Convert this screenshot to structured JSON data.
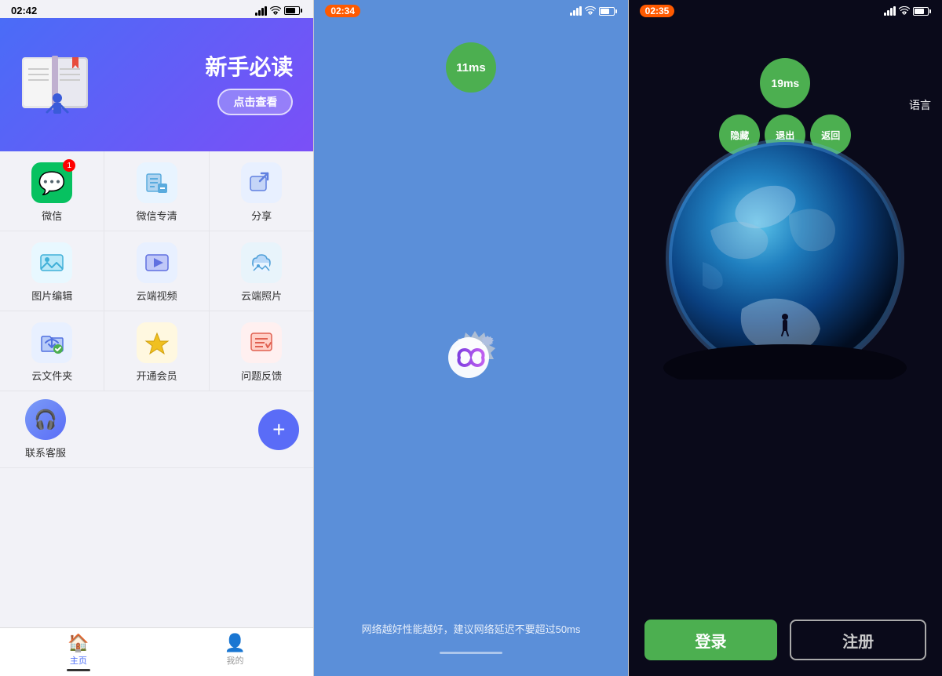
{
  "phone1": {
    "time": "02:42",
    "banner": {
      "title": "新手必读",
      "button": "点击查看"
    },
    "grid": [
      [
        {
          "label": "微信",
          "icon": "💬",
          "iconClass": "icon-wechat",
          "badge": "1"
        },
        {
          "label": "微信专清",
          "icon": "🧹",
          "iconClass": "icon-wechat-clean"
        },
        {
          "label": "分享",
          "icon": "↗",
          "iconClass": "icon-share"
        }
      ],
      [
        {
          "label": "图片编辑",
          "icon": "🖼",
          "iconClass": "icon-photo-edit"
        },
        {
          "label": "云端视频",
          "icon": "▶",
          "iconClass": "icon-cloud-video"
        },
        {
          "label": "云端照片",
          "icon": "🌤",
          "iconClass": "icon-cloud-photo"
        }
      ],
      [
        {
          "label": "云文件夹",
          "icon": "☁",
          "iconClass": "icon-cloud-folder"
        },
        {
          "label": "开通会员",
          "icon": "👑",
          "iconClass": "icon-vip"
        },
        {
          "label": "问题反馈",
          "icon": "📝",
          "iconClass": "icon-feedback"
        }
      ]
    ],
    "service": {
      "label": "联系客服",
      "icon": "🎧"
    },
    "add_label": "+",
    "tabs": [
      {
        "label": "主页",
        "icon": "🏠",
        "active": true
      },
      {
        "label": "我的",
        "icon": "👤",
        "active": false
      }
    ]
  },
  "phone2": {
    "time": "02:34",
    "ping": "11ms",
    "hint": "网络越好性能越好，建议网络延迟不要超过50ms"
  },
  "phone3": {
    "time": "02:35",
    "ping": "19ms",
    "menu": [
      "隐藏",
      "退出",
      "返回"
    ],
    "language_label": "语言",
    "login_label": "登录",
    "register_label": "注册"
  },
  "icons": {
    "signal": "▌▌▌",
    "wifi": "WiFi",
    "battery": "▮"
  }
}
